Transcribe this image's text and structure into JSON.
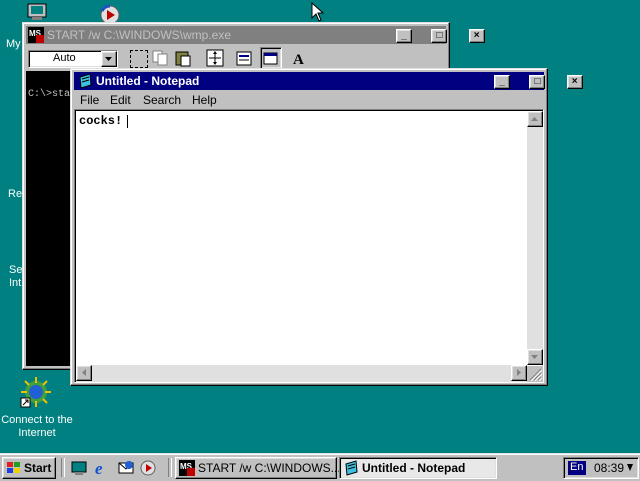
{
  "desktop": {
    "icons": [
      {
        "label_visible": "My"
      },
      {
        "label_visible": "Re"
      },
      {
        "label_visible": "Se"
      },
      {
        "label_visible": "Int"
      }
    ],
    "connect_icon": {
      "line1": "Connect to the",
      "line2": "Internet"
    }
  },
  "dos_window": {
    "title": "START /w C:\\WINDOWS\\wmp.exe",
    "font_select": "Auto",
    "prompt_text": "C:\\>star"
  },
  "notepad": {
    "title": "Untitled - Notepad",
    "menu": [
      "File",
      "Edit",
      "Search",
      "Help"
    ],
    "content": "cocks!"
  },
  "taskbar": {
    "start_label": "Start",
    "tasks": [
      {
        "label": "START /w C:\\WINDOWS..."
      },
      {
        "label": "Untitled - Notepad"
      }
    ],
    "tray": {
      "lang": "En",
      "time": "08:39"
    }
  },
  "colors": {
    "desktop": "#008080",
    "title_active": "#000080",
    "title_inactive": "#808080",
    "face": "#c0c0c0"
  }
}
